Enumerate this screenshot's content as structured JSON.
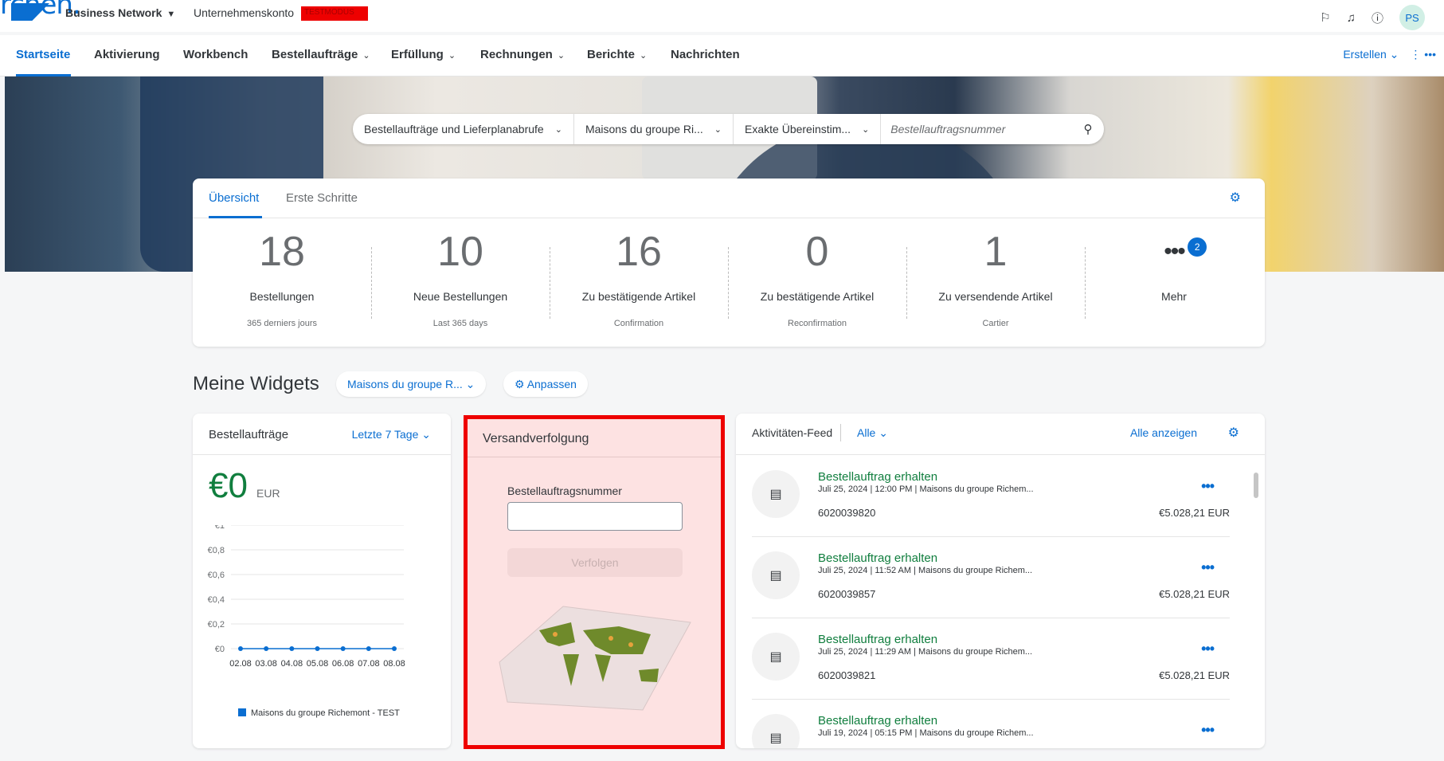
{
  "app": {
    "logo_overlay": "rchen.",
    "brand": "Business Network",
    "account_label": "Unternehmenskonto",
    "account_badge": "TESTMODUS",
    "user_initials": "PS"
  },
  "nav": {
    "items": [
      {
        "label": "Startseite"
      },
      {
        "label": "Aktivierung"
      },
      {
        "label": "Workbench"
      },
      {
        "label": "Bestellaufträge"
      },
      {
        "label": "Erfüllung"
      },
      {
        "label": "Rechnungen"
      },
      {
        "label": "Berichte"
      },
      {
        "label": "Nachrichten"
      }
    ],
    "create_label": "Erstellen"
  },
  "search": {
    "type": "Bestellaufträge und Lieferplanabrufe",
    "customer": "Maisons du groupe Ri...",
    "match": "Exakte Übereinstim...",
    "placeholder": "Bestellauftragsnummer"
  },
  "overview": {
    "tabs": [
      "Übersicht",
      "Erste Schritte"
    ],
    "tiles": [
      {
        "value": "18",
        "label": "Bestellungen",
        "sub": "365 derniers jours"
      },
      {
        "value": "10",
        "label": "Neue Bestellungen",
        "sub": "Last 365 days"
      },
      {
        "value": "16",
        "label": "Zu bestätigende Artikel",
        "sub": "Confirmation"
      },
      {
        "value": "0",
        "label": "Zu bestätigende Artikel",
        "sub": "Reconfirmation"
      },
      {
        "value": "1",
        "label": "Zu versendende Artikel",
        "sub": "Cartier"
      }
    ],
    "more_label": "Mehr",
    "more_badge": "2"
  },
  "widgets": {
    "title": "Meine Widgets",
    "filter": "Maisons du groupe R...",
    "customize": "Anpassen"
  },
  "orders_widget": {
    "title": "Bestellaufträge",
    "range": "Letzte 7 Tage",
    "amount": "€0",
    "currency": "EUR",
    "legend": "Maisons du groupe Richemont - TEST"
  },
  "chart_data": {
    "type": "line",
    "categories": [
      "02.08",
      "03.08",
      "04.08",
      "05.08",
      "06.08",
      "07.08",
      "08.08"
    ],
    "series": [
      {
        "name": "Maisons du groupe Richemont - TEST",
        "values": [
          0,
          0,
          0,
          0,
          0,
          0,
          0
        ]
      }
    ],
    "yticks": [
      "€1",
      "€0,8",
      "€0,6",
      "€0,4",
      "€0,2",
      "€0"
    ],
    "ylim": [
      0,
      1
    ],
    "color": "#0a6ed1"
  },
  "tracking_widget": {
    "title": "Versandverfolgung",
    "field_label": "Bestellauftragsnummer",
    "button": "Verfolgen"
  },
  "feed": {
    "title": "Aktivitäten-Feed",
    "filter": "Alle",
    "show_all": "Alle anzeigen",
    "items": [
      {
        "title": "Bestellauftrag erhalten",
        "date": "Juli 25, 2024",
        "time": "12:00 PM",
        "customer": "Maisons du groupe Richem...",
        "number": "6020039820",
        "amount": "€5.028,21 EUR"
      },
      {
        "title": "Bestellauftrag erhalten",
        "date": "Juli 25, 2024",
        "time": "11:52 AM",
        "customer": "Maisons du groupe Richem...",
        "number": "6020039857",
        "amount": "€5.028,21 EUR"
      },
      {
        "title": "Bestellauftrag erhalten",
        "date": "Juli 25, 2024",
        "time": "11:29 AM",
        "customer": "Maisons du groupe Richem...",
        "number": "6020039821",
        "amount": "€5.028,21 EUR"
      },
      {
        "title": "Bestellauftrag erhalten",
        "date": "Juli 19, 2024",
        "time": "05:15 PM",
        "customer": "Maisons du groupe Richem...",
        "number": "",
        "amount": ""
      }
    ]
  }
}
